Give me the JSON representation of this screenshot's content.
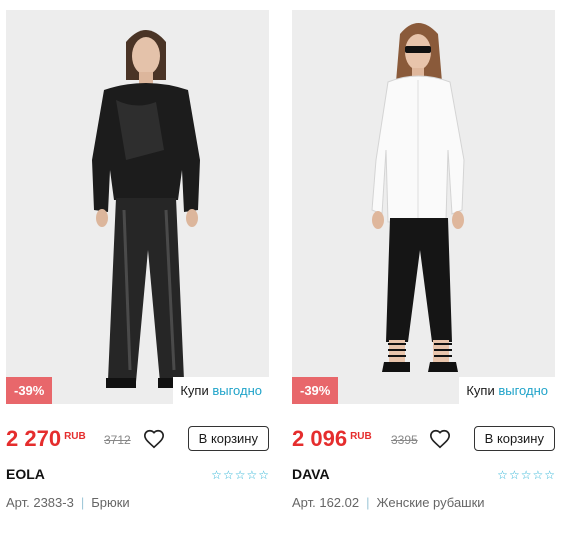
{
  "products": [
    {
      "discount": "-39%",
      "promo_prefix": "Купи",
      "promo_accent": "выгодно",
      "price": "2 270",
      "currency": "RUB",
      "old_price": "3712",
      "cart_label": "В корзину",
      "brand": "EOLA",
      "article": "Арт. 2383-3",
      "category": "Брюки",
      "rating": 0,
      "outfit": "black sweatshirt and black leather trousers"
    },
    {
      "discount": "-39%",
      "promo_prefix": "Купи",
      "promo_accent": "выгодно",
      "price": "2 096",
      "currency": "RUB",
      "old_price": "3395",
      "cart_label": "В корзину",
      "brand": "DAVA",
      "article": "Арт. 162.02",
      "category": "Женские рубашки",
      "rating": 0,
      "outfit": "white shirt and black cropped trousers"
    }
  ],
  "colors": {
    "price": "#e52d2d",
    "discount_badge": "#e8676b",
    "accent": "#1fa3c9",
    "photo_bg": "#ececec"
  },
  "icons": [
    "heart-icon",
    "star-icon"
  ]
}
